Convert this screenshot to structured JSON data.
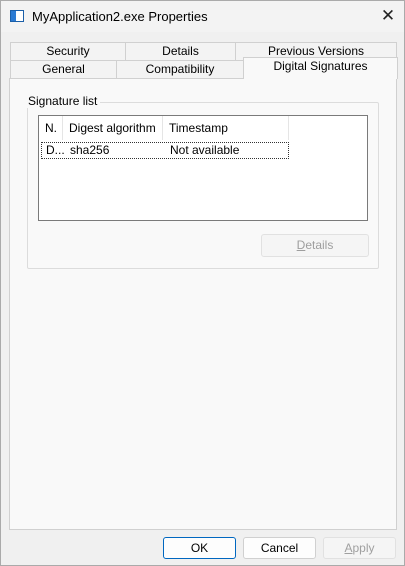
{
  "window": {
    "title": "MyApplication2.exe Properties",
    "icon": "application-window-icon",
    "close_glyph": "✕"
  },
  "tabs": {
    "row1": [
      {
        "label": "Security"
      },
      {
        "label": "Details"
      },
      {
        "label": "Previous Versions"
      }
    ],
    "row2": [
      {
        "label": "General"
      },
      {
        "label": "Compatibility"
      },
      {
        "label": "Digital Signatures",
        "active": true
      }
    ]
  },
  "signatures": {
    "group_label": "Signature list",
    "columns": [
      "N.",
      "Digest algorithm",
      "Timestamp"
    ],
    "rows": [
      {
        "name": "D...",
        "digest": "sha256",
        "timestamp": "Not available"
      }
    ],
    "details_button": {
      "first": "D",
      "rest": "etails",
      "enabled": false
    }
  },
  "buttons": {
    "ok": "OK",
    "cancel": "Cancel",
    "apply_first": "A",
    "apply_rest": "pply",
    "apply_enabled": false
  },
  "colors": {
    "accent": "#0067c0",
    "disabled_text": "#a0a0a0"
  }
}
